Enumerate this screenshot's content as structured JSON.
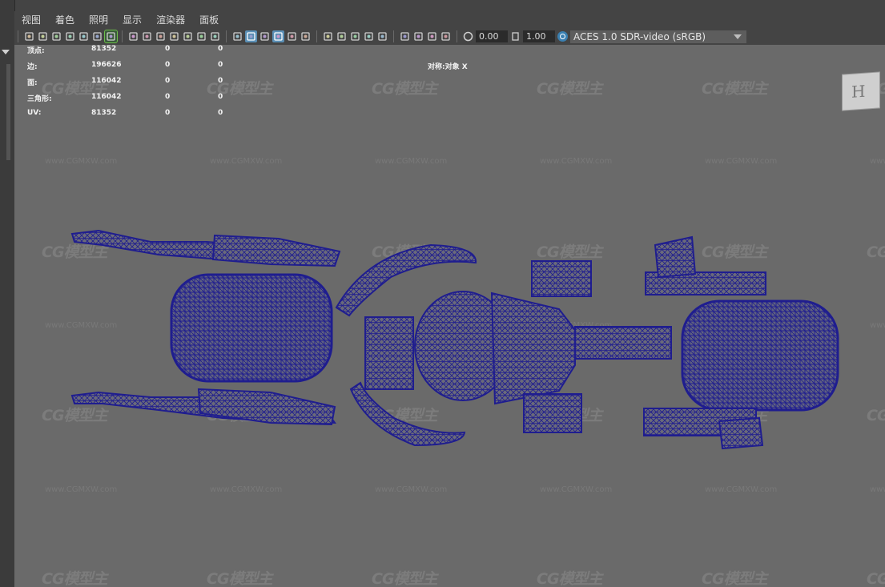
{
  "menu": [
    "视图",
    "着色",
    "照明",
    "显示",
    "渲染器",
    "面板"
  ],
  "toolbar": {
    "icons": [
      "camera-select-icon",
      "camera-attributes-icon",
      "bookmark-icon",
      "image-plane-icon",
      "grease-pencil-icon",
      "2d-pan-zoom-icon",
      "wireframe-toggle-icon",
      "grid-icon",
      "film-gate-icon",
      "resolution-gate-icon",
      "gate-mask-icon",
      "field-chart-icon",
      "safe-action-icon",
      "safe-title-icon",
      "wireframe-icon",
      "smooth-shade-icon",
      "default-material-icon",
      "wireframe-on-shaded-icon",
      "textured-icon",
      "use-all-lights-icon",
      "shadows-icon",
      "ambient-occlusion-icon",
      "motion-blur-icon",
      "multisample-aa-icon",
      "depth-of-field-icon",
      "isolate-select-icon",
      "xray-icon",
      "xray-joints-icon",
      "backface-culling-icon",
      "exposure-icon",
      "gamma-icon",
      "color-management-icon"
    ],
    "exposure_value": "0.00",
    "gamma_value": "1.00",
    "color_space": "ACES 1.0 SDR-video (sRGB)"
  },
  "hud": {
    "rows": [
      {
        "label": "顶点:",
        "value": "81352",
        "col2": "0",
        "col3": "0"
      },
      {
        "label": "边:",
        "value": "196626",
        "col2": "0",
        "col3": "0"
      },
      {
        "label": "面:",
        "value": "116042",
        "col2": "0",
        "col3": "0"
      },
      {
        "label": "三角形:",
        "value": "116042",
        "col2": "0",
        "col3": "0"
      },
      {
        "label": "UV:",
        "value": "81352",
        "col2": "0",
        "col3": "0"
      }
    ],
    "symmetry": "对称:对象 X"
  },
  "viewcube_label": "H",
  "watermark": {
    "logo": "CG模型主",
    "url": "www.CGMXW.com"
  },
  "colors": {
    "wire": "#1f1d8f",
    "viewport_bg": "#6a6a6a",
    "ui_bg": "#444444",
    "accent_selected": "#5a8fb5"
  }
}
